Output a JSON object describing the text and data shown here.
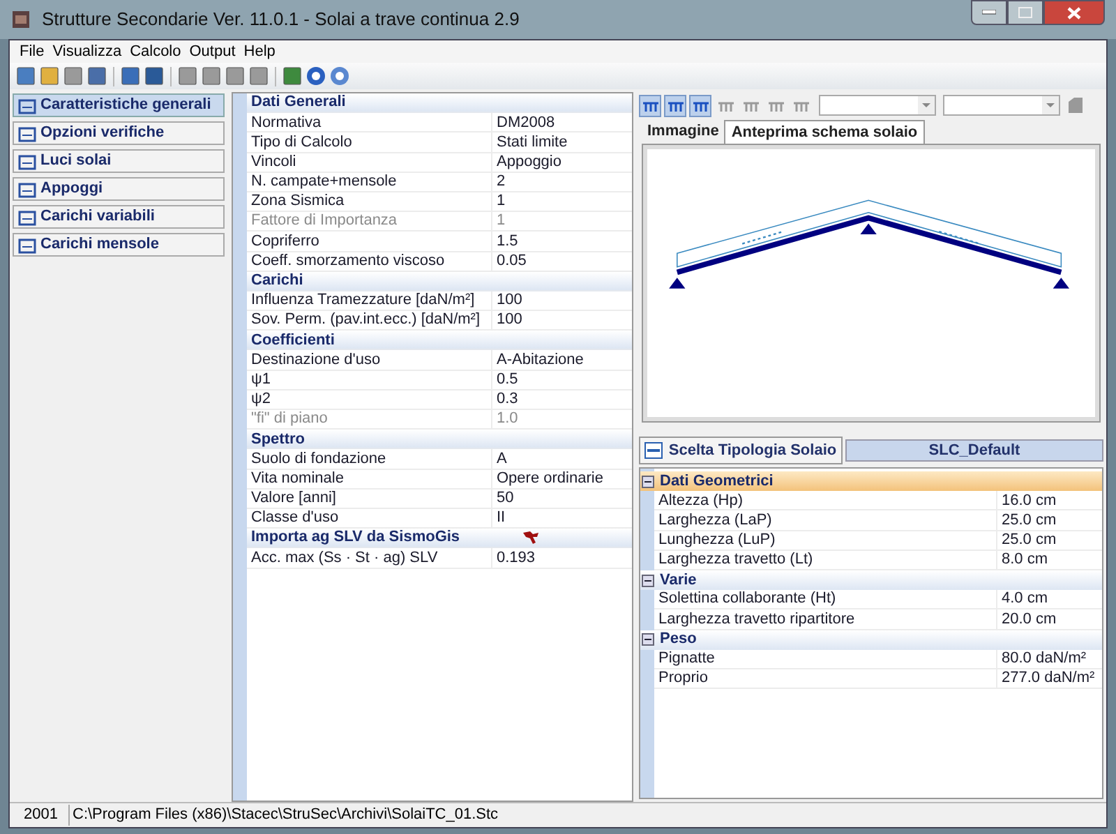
{
  "window": {
    "title": "Strutture Secondarie Ver. 11.0.1 - Solai a trave continua 2.9"
  },
  "menu": [
    "File",
    "Visualizza",
    "Calcolo",
    "Output",
    "Help"
  ],
  "toolbar": [
    {
      "disabled": false
    },
    {
      "disabled": false
    },
    {
      "disabled": true
    },
    {
      "disabled": false
    },
    {
      "disabled": false
    },
    {
      "disabled": false
    },
    {
      "disabled": true
    },
    {
      "disabled": true
    },
    {
      "disabled": true
    },
    {
      "disabled": true
    },
    {
      "disabled": false
    },
    {
      "disabled": false
    },
    {
      "disabled": false
    }
  ],
  "nav": [
    {
      "label": "Caratteristiche generali",
      "selected": true
    },
    {
      "label": "Opzioni verifiche",
      "selected": false
    },
    {
      "label": "Luci solai",
      "selected": false
    },
    {
      "label": "Appoggi",
      "selected": false
    },
    {
      "label": "Carichi variabili",
      "selected": false
    },
    {
      "label": "Carichi mensole",
      "selected": false
    }
  ],
  "properties": [
    {
      "section": "Dati Generali",
      "rows": [
        {
          "label": "Normativa",
          "value": "DM2008",
          "disabled": false
        },
        {
          "label": "Tipo di Calcolo",
          "value": "Stati limite",
          "disabled": false
        },
        {
          "label": "Vincoli",
          "value": "Appoggio",
          "disabled": false
        },
        {
          "label": "N. campate+mensole",
          "value": "2",
          "disabled": false
        },
        {
          "label": "Zona Sismica",
          "value": "1",
          "disabled": false
        },
        {
          "label": "Fattore di Importanza",
          "value": "1",
          "disabled": true
        },
        {
          "label": "Copriferro",
          "value": "1.5",
          "disabled": false
        },
        {
          "label": "Coeff. smorzamento viscoso",
          "value": "0.05",
          "disabled": false
        }
      ]
    },
    {
      "section": "Carichi",
      "rows": [
        {
          "label": "Influenza Tramezzature [daN/m²]",
          "value": "100",
          "disabled": false
        },
        {
          "label": "Sov. Perm. (pav.int.ecc.) [daN/m²]",
          "value": "100",
          "disabled": false
        }
      ]
    },
    {
      "section": "Coefficienti",
      "rows": [
        {
          "label": "Destinazione d'uso",
          "value": "A-Abitazione",
          "disabled": false
        },
        {
          "label": "ψ1",
          "value": "0.5",
          "disabled": false
        },
        {
          "label": "ψ2",
          "value": "0.3",
          "disabled": false
        },
        {
          "label": "\"fi\" di piano",
          "value": "1.0",
          "disabled": true
        }
      ]
    },
    {
      "section": "Spettro",
      "rows": [
        {
          "label": "Suolo di fondazione",
          "value": "A",
          "disabled": false
        },
        {
          "label": "Vita nominale",
          "value": "Opere ordinarie",
          "disabled": false
        },
        {
          "label": "Valore [anni]",
          "value": "50",
          "disabled": false
        },
        {
          "label": "Classe d'uso",
          "value": "II",
          "disabled": false
        }
      ]
    },
    {
      "section": "Importa ag SLV da SismoGis",
      "kind": "import",
      "rows": [
        {
          "label": "Acc. max (Ss · St · ag) SLV",
          "value": "0.193",
          "disabled": false
        }
      ]
    }
  ],
  "preview": {
    "toolbar": [
      {
        "selected": true
      },
      {
        "selected": true
      },
      {
        "selected": true
      },
      {
        "selected": false
      },
      {
        "selected": false
      },
      {
        "selected": false
      },
      {
        "selected": false
      }
    ],
    "tabs": [
      {
        "label": "Immagine",
        "selected": false
      },
      {
        "label": "Anteprima schema solaio",
        "selected": true
      }
    ]
  },
  "slab": {
    "button": "Scelta Tipologia Solaio",
    "type": "SLC_Default",
    "groups": [
      {
        "section": "Dati Geometrici",
        "expanded": true,
        "selected": true,
        "rows": [
          {
            "label": "Altezza (Hp)",
            "value": "16.0 cm"
          },
          {
            "label": "Larghezza (LaP)",
            "value": "25.0 cm"
          },
          {
            "label": "Lunghezza (LuP)",
            "value": "25.0 cm"
          },
          {
            "label": "Larghezza travetto (Lt)",
            "value": "8.0 cm"
          }
        ]
      },
      {
        "section": "Varie",
        "expanded": true,
        "selected": false,
        "rows": [
          {
            "label": "Solettina collaborante (Ht)",
            "value": "4.0 cm"
          },
          {
            "label": "Larghezza travetto ripartitore",
            "value": "20.0 cm"
          }
        ]
      },
      {
        "section": "Peso",
        "expanded": true,
        "selected": false,
        "rows": [
          {
            "label": "Pignatte",
            "value": "80.0 daN/m²"
          },
          {
            "label": "Proprio",
            "value": "277.0 daN/m²"
          }
        ]
      }
    ]
  },
  "status_bar": {
    "code": "2001",
    "path": "C:\\Program Files (x86)\\Stacec\\StruSec\\Archivi\\SolaiTC_01.Stc"
  }
}
